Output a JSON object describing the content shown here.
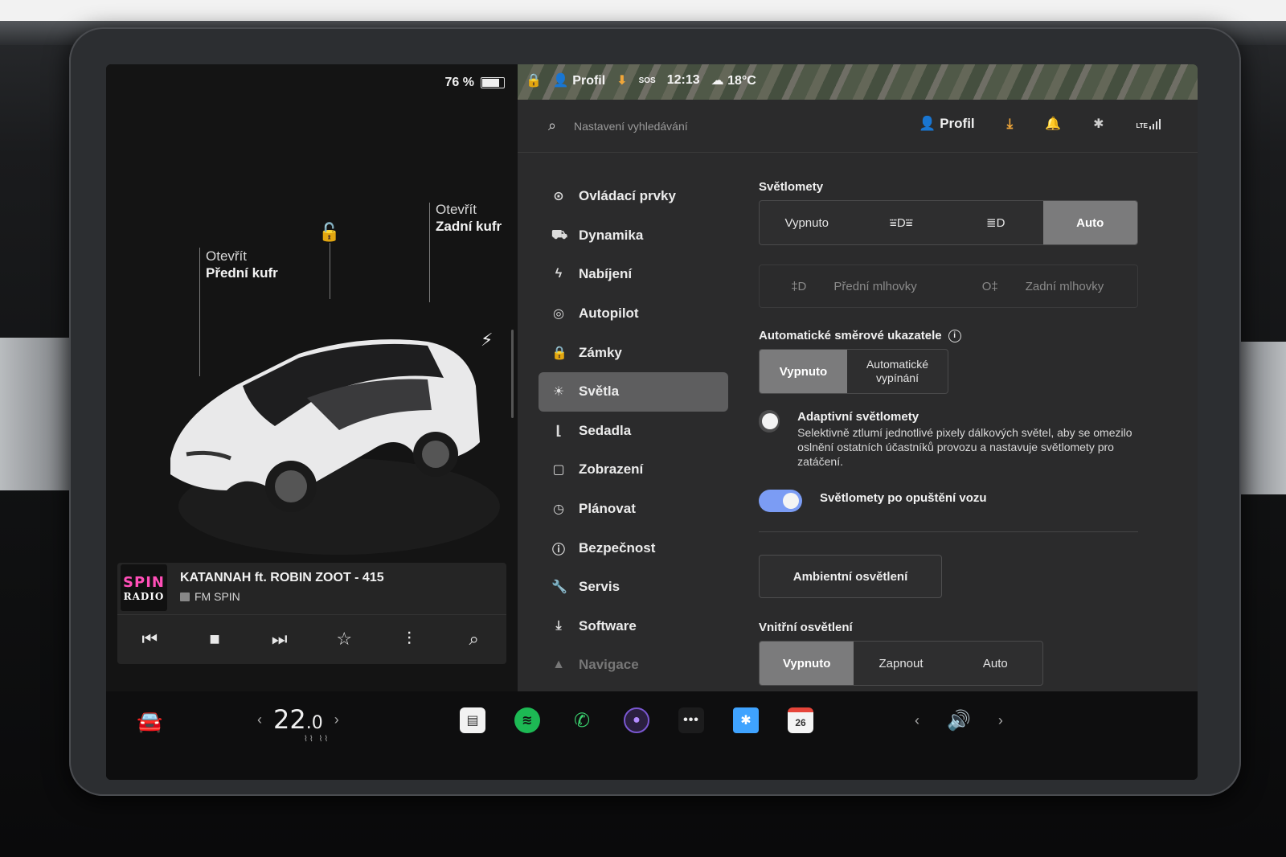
{
  "status": {
    "battery_percent": "76 %",
    "profile_label": "Profil",
    "sos": "SOS",
    "time": "12:13",
    "temperature": "18°C"
  },
  "car": {
    "front_trunk_action": "Otevřít",
    "front_trunk_name": "Přední kufr",
    "rear_trunk_action": "Otevřít",
    "rear_trunk_name": "Zadní kufr"
  },
  "media": {
    "logo_top": "SPIN",
    "logo_bottom": "RADIO",
    "track": "KATANNAH ft. ROBIN ZOOT - 415",
    "station": "FM SPIN"
  },
  "topbar": {
    "search_placeholder": "Nastavení vyhledávání",
    "profile": "Profil",
    "lte": "LTE"
  },
  "nav": {
    "items": [
      {
        "label": "Ovládací prvky",
        "icon": "toggle-icon"
      },
      {
        "label": "Dynamika",
        "icon": "car-icon"
      },
      {
        "label": "Nabíjení",
        "icon": "bolt-icon"
      },
      {
        "label": "Autopilot",
        "icon": "steering-wheel-icon"
      },
      {
        "label": "Zámky",
        "icon": "lock-icon"
      },
      {
        "label": "Světla",
        "icon": "sun-icon"
      },
      {
        "label": "Sedadla",
        "icon": "seat-icon"
      },
      {
        "label": "Zobrazení",
        "icon": "display-icon"
      },
      {
        "label": "Plánovat",
        "icon": "clock-icon"
      },
      {
        "label": "Bezpečnost",
        "icon": "alert-icon"
      },
      {
        "label": "Servis",
        "icon": "wrench-icon"
      },
      {
        "label": "Software",
        "icon": "download-icon"
      },
      {
        "label": "Navigace",
        "icon": "navigation-icon"
      }
    ],
    "active": "Světla"
  },
  "lights": {
    "headlights_title": "Světlomety",
    "headlights_options": {
      "off": "Vypnuto",
      "auto": "Auto"
    },
    "headlights_selected": "Auto",
    "fog_front": "Přední mlhovky",
    "fog_rear": "Zadní mlhovky",
    "turn_signals_title": "Automatické směrové ukazatele",
    "turn_signals_off": "Vypnuto",
    "turn_signals_auto": "Automatické vypínání",
    "turn_signals_selected": "Vypnuto",
    "adaptive_title": "Adaptivní světlomety",
    "adaptive_desc": "Selektivně ztlumí jednotlivé pixely dálkových světel, aby se omezilo oslnění ostatních účastníků provozu a nastavuje světlomety pro zatáčení.",
    "adaptive_on": false,
    "exit_lights_title": "Světlomety po opuštění vozu",
    "exit_lights_on": true,
    "ambient_button": "Ambientní osvětlení",
    "interior_title": "Vnitřní osvětlení",
    "interior_options": [
      "Vypnuto",
      "Zapnout",
      "Auto"
    ],
    "interior_selected": "Vypnuto"
  },
  "bottom": {
    "temperature_int": "22",
    "temperature_dec": ".0",
    "calendar_day": "26"
  }
}
